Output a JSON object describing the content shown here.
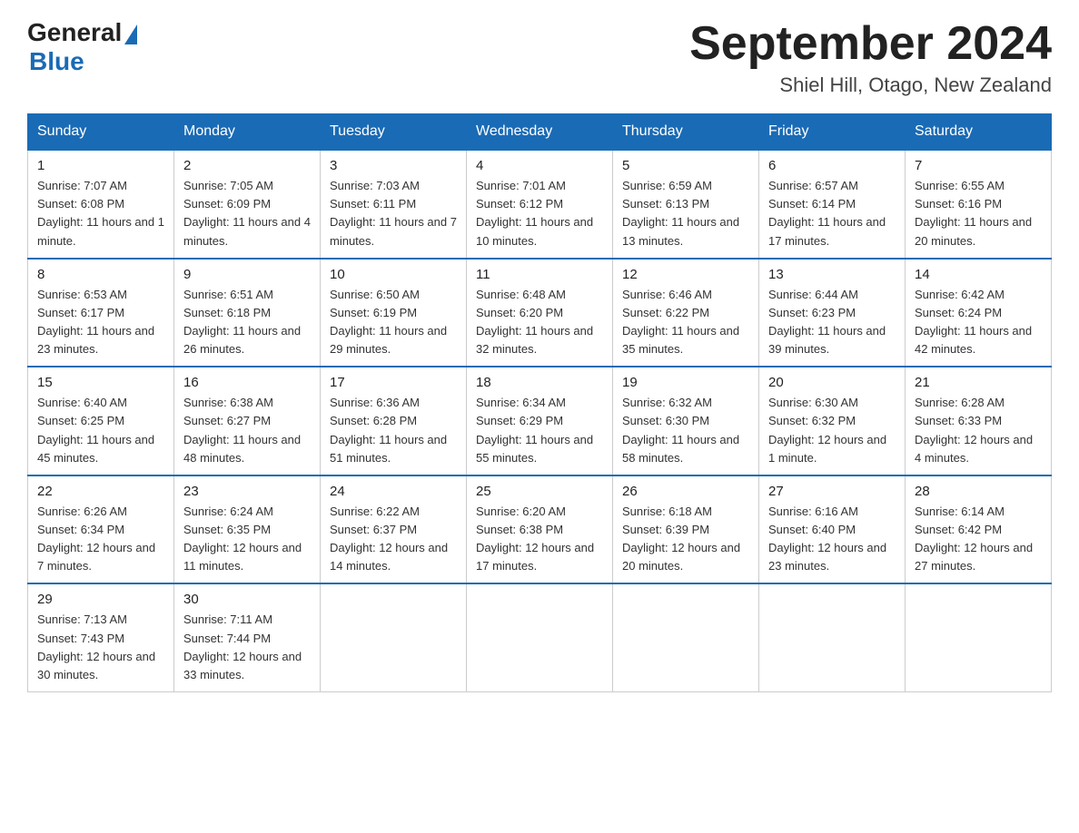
{
  "logo": {
    "general": "General",
    "blue": "Blue",
    "subtitle": "Blue"
  },
  "header": {
    "month_year": "September 2024",
    "location": "Shiel Hill, Otago, New Zealand"
  },
  "days_of_week": [
    "Sunday",
    "Monday",
    "Tuesday",
    "Wednesday",
    "Thursday",
    "Friday",
    "Saturday"
  ],
  "weeks": [
    [
      {
        "day": "1",
        "sunrise": "7:07 AM",
        "sunset": "6:08 PM",
        "daylight": "11 hours and 1 minute."
      },
      {
        "day": "2",
        "sunrise": "7:05 AM",
        "sunset": "6:09 PM",
        "daylight": "11 hours and 4 minutes."
      },
      {
        "day": "3",
        "sunrise": "7:03 AM",
        "sunset": "6:11 PM",
        "daylight": "11 hours and 7 minutes."
      },
      {
        "day": "4",
        "sunrise": "7:01 AM",
        "sunset": "6:12 PM",
        "daylight": "11 hours and 10 minutes."
      },
      {
        "day": "5",
        "sunrise": "6:59 AM",
        "sunset": "6:13 PM",
        "daylight": "11 hours and 13 minutes."
      },
      {
        "day": "6",
        "sunrise": "6:57 AM",
        "sunset": "6:14 PM",
        "daylight": "11 hours and 17 minutes."
      },
      {
        "day": "7",
        "sunrise": "6:55 AM",
        "sunset": "6:16 PM",
        "daylight": "11 hours and 20 minutes."
      }
    ],
    [
      {
        "day": "8",
        "sunrise": "6:53 AM",
        "sunset": "6:17 PM",
        "daylight": "11 hours and 23 minutes."
      },
      {
        "day": "9",
        "sunrise": "6:51 AM",
        "sunset": "6:18 PM",
        "daylight": "11 hours and 26 minutes."
      },
      {
        "day": "10",
        "sunrise": "6:50 AM",
        "sunset": "6:19 PM",
        "daylight": "11 hours and 29 minutes."
      },
      {
        "day": "11",
        "sunrise": "6:48 AM",
        "sunset": "6:20 PM",
        "daylight": "11 hours and 32 minutes."
      },
      {
        "day": "12",
        "sunrise": "6:46 AM",
        "sunset": "6:22 PM",
        "daylight": "11 hours and 35 minutes."
      },
      {
        "day": "13",
        "sunrise": "6:44 AM",
        "sunset": "6:23 PM",
        "daylight": "11 hours and 39 minutes."
      },
      {
        "day": "14",
        "sunrise": "6:42 AM",
        "sunset": "6:24 PM",
        "daylight": "11 hours and 42 minutes."
      }
    ],
    [
      {
        "day": "15",
        "sunrise": "6:40 AM",
        "sunset": "6:25 PM",
        "daylight": "11 hours and 45 minutes."
      },
      {
        "day": "16",
        "sunrise": "6:38 AM",
        "sunset": "6:27 PM",
        "daylight": "11 hours and 48 minutes."
      },
      {
        "day": "17",
        "sunrise": "6:36 AM",
        "sunset": "6:28 PM",
        "daylight": "11 hours and 51 minutes."
      },
      {
        "day": "18",
        "sunrise": "6:34 AM",
        "sunset": "6:29 PM",
        "daylight": "11 hours and 55 minutes."
      },
      {
        "day": "19",
        "sunrise": "6:32 AM",
        "sunset": "6:30 PM",
        "daylight": "11 hours and 58 minutes."
      },
      {
        "day": "20",
        "sunrise": "6:30 AM",
        "sunset": "6:32 PM",
        "daylight": "12 hours and 1 minute."
      },
      {
        "day": "21",
        "sunrise": "6:28 AM",
        "sunset": "6:33 PM",
        "daylight": "12 hours and 4 minutes."
      }
    ],
    [
      {
        "day": "22",
        "sunrise": "6:26 AM",
        "sunset": "6:34 PM",
        "daylight": "12 hours and 7 minutes."
      },
      {
        "day": "23",
        "sunrise": "6:24 AM",
        "sunset": "6:35 PM",
        "daylight": "12 hours and 11 minutes."
      },
      {
        "day": "24",
        "sunrise": "6:22 AM",
        "sunset": "6:37 PM",
        "daylight": "12 hours and 14 minutes."
      },
      {
        "day": "25",
        "sunrise": "6:20 AM",
        "sunset": "6:38 PM",
        "daylight": "12 hours and 17 minutes."
      },
      {
        "day": "26",
        "sunrise": "6:18 AM",
        "sunset": "6:39 PM",
        "daylight": "12 hours and 20 minutes."
      },
      {
        "day": "27",
        "sunrise": "6:16 AM",
        "sunset": "6:40 PM",
        "daylight": "12 hours and 23 minutes."
      },
      {
        "day": "28",
        "sunrise": "6:14 AM",
        "sunset": "6:42 PM",
        "daylight": "12 hours and 27 minutes."
      }
    ],
    [
      {
        "day": "29",
        "sunrise": "7:13 AM",
        "sunset": "7:43 PM",
        "daylight": "12 hours and 30 minutes."
      },
      {
        "day": "30",
        "sunrise": "7:11 AM",
        "sunset": "7:44 PM",
        "daylight": "12 hours and 33 minutes."
      },
      null,
      null,
      null,
      null,
      null
    ]
  ]
}
